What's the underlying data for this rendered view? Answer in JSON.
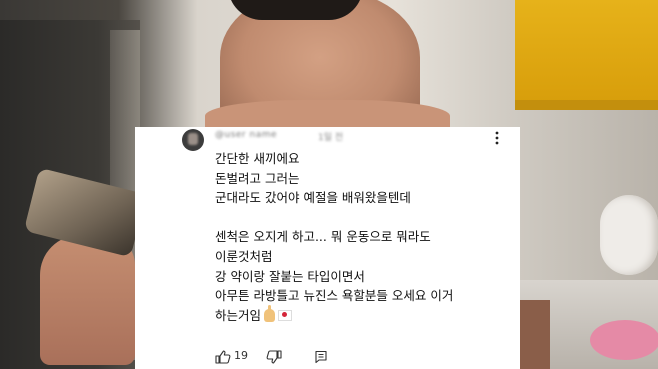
{
  "comment": {
    "username": "@user name",
    "timestamp": "1일 전",
    "lines": [
      "간단한 새끼에요",
      "돈벌려고 그러는",
      "군대라도 갔어야 예절을 배워왔을텐데",
      "",
      "센척은 오지게 하고... 뭐 운동으로 뭐라도",
      "이룬것처럼",
      "강 약이랑 잘붙는 타입이면서",
      "아무튼 라방틀고 뉴진스 욕할분들 오세요 이거",
      "하는거임"
    ],
    "emoji_after_last_line": [
      "hand-emoji",
      "japan-flag-emoji"
    ],
    "like_count": "19"
  },
  "icons": {
    "avatar": "avatar",
    "menu": "more-vertical-icon",
    "like": "thumbs-up-icon",
    "dislike": "thumbs-down-icon",
    "reply": "reply-icon"
  },
  "colors": {
    "card_background": "#ffffff",
    "text": "#0f0f0f",
    "secondary_text": "#606060",
    "cabinet_accent": "#e6b21a"
  }
}
